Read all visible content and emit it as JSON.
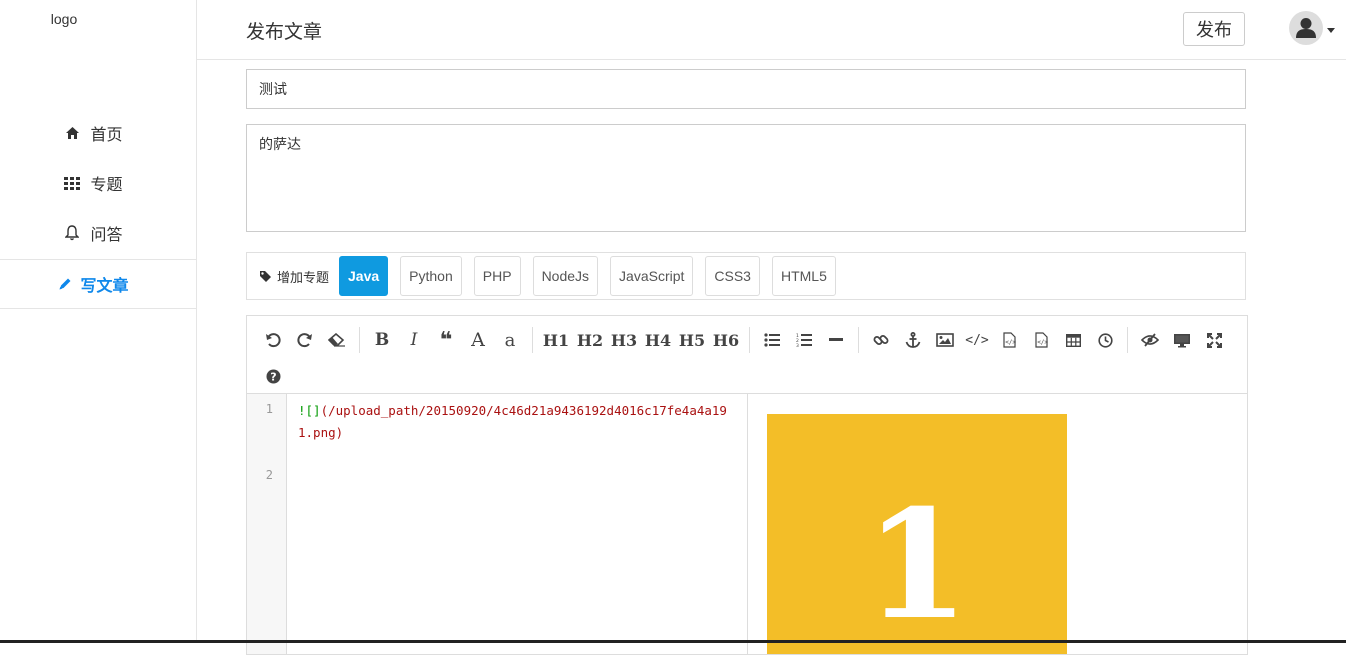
{
  "sidebar": {
    "logo": "logo",
    "items": [
      {
        "label": "首页",
        "icon": "home-icon"
      },
      {
        "label": "专题",
        "icon": "grid-icon"
      },
      {
        "label": "问答",
        "icon": "bell-icon"
      }
    ],
    "write": {
      "label": "写文章",
      "icon": "pencil-icon"
    }
  },
  "header": {
    "title": "发布文章",
    "publish_label": "发布",
    "avatar_icon": "user-avatar-icon"
  },
  "form": {
    "title_value": "测试",
    "summary_value": "的萨达"
  },
  "tags": {
    "add_label": "增加专题",
    "items": [
      "Java",
      "Python",
      "PHP",
      "NodeJs",
      "JavaScript",
      "CSS3",
      "HTML5"
    ],
    "active": "Java"
  },
  "editor": {
    "toolbar_headings": [
      "H1",
      "H2",
      "H3",
      "H4",
      "H5",
      "H6"
    ],
    "lines": [
      "1",
      "2"
    ],
    "code_line1_prefix": "![]",
    "code_line1_rest": "(/upload_path/20150920/4c46d21a9436192d4016c17fe4a4a191.png)",
    "preview_number": "1"
  },
  "colors": {
    "accent": "#0f88eb",
    "tag_active": "#0f9ae0",
    "preview_bg": "#f3be28"
  }
}
